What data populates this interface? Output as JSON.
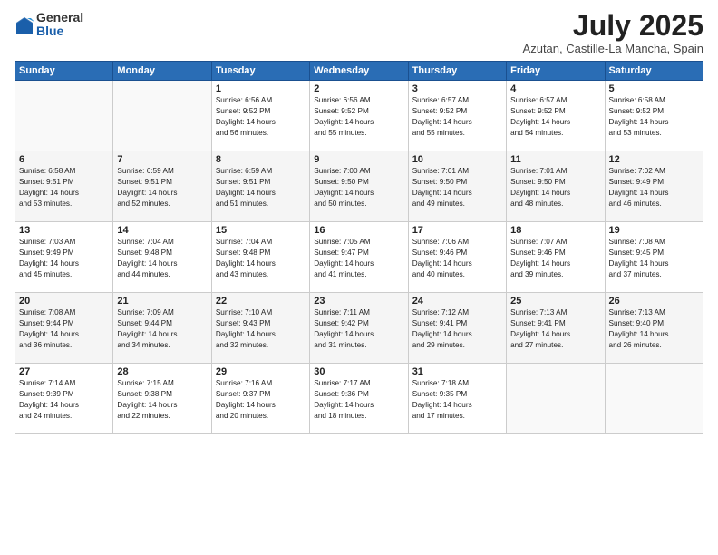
{
  "logo": {
    "general": "General",
    "blue": "Blue"
  },
  "title": "July 2025",
  "location": "Azutan, Castille-La Mancha, Spain",
  "weekdays": [
    "Sunday",
    "Monday",
    "Tuesday",
    "Wednesday",
    "Thursday",
    "Friday",
    "Saturday"
  ],
  "weeks": [
    [
      {
        "day": "",
        "info": ""
      },
      {
        "day": "",
        "info": ""
      },
      {
        "day": "1",
        "info": "Sunrise: 6:56 AM\nSunset: 9:52 PM\nDaylight: 14 hours\nand 56 minutes."
      },
      {
        "day": "2",
        "info": "Sunrise: 6:56 AM\nSunset: 9:52 PM\nDaylight: 14 hours\nand 55 minutes."
      },
      {
        "day": "3",
        "info": "Sunrise: 6:57 AM\nSunset: 9:52 PM\nDaylight: 14 hours\nand 55 minutes."
      },
      {
        "day": "4",
        "info": "Sunrise: 6:57 AM\nSunset: 9:52 PM\nDaylight: 14 hours\nand 54 minutes."
      },
      {
        "day": "5",
        "info": "Sunrise: 6:58 AM\nSunset: 9:52 PM\nDaylight: 14 hours\nand 53 minutes."
      }
    ],
    [
      {
        "day": "6",
        "info": "Sunrise: 6:58 AM\nSunset: 9:51 PM\nDaylight: 14 hours\nand 53 minutes."
      },
      {
        "day": "7",
        "info": "Sunrise: 6:59 AM\nSunset: 9:51 PM\nDaylight: 14 hours\nand 52 minutes."
      },
      {
        "day": "8",
        "info": "Sunrise: 6:59 AM\nSunset: 9:51 PM\nDaylight: 14 hours\nand 51 minutes."
      },
      {
        "day": "9",
        "info": "Sunrise: 7:00 AM\nSunset: 9:50 PM\nDaylight: 14 hours\nand 50 minutes."
      },
      {
        "day": "10",
        "info": "Sunrise: 7:01 AM\nSunset: 9:50 PM\nDaylight: 14 hours\nand 49 minutes."
      },
      {
        "day": "11",
        "info": "Sunrise: 7:01 AM\nSunset: 9:50 PM\nDaylight: 14 hours\nand 48 minutes."
      },
      {
        "day": "12",
        "info": "Sunrise: 7:02 AM\nSunset: 9:49 PM\nDaylight: 14 hours\nand 46 minutes."
      }
    ],
    [
      {
        "day": "13",
        "info": "Sunrise: 7:03 AM\nSunset: 9:49 PM\nDaylight: 14 hours\nand 45 minutes."
      },
      {
        "day": "14",
        "info": "Sunrise: 7:04 AM\nSunset: 9:48 PM\nDaylight: 14 hours\nand 44 minutes."
      },
      {
        "day": "15",
        "info": "Sunrise: 7:04 AM\nSunset: 9:48 PM\nDaylight: 14 hours\nand 43 minutes."
      },
      {
        "day": "16",
        "info": "Sunrise: 7:05 AM\nSunset: 9:47 PM\nDaylight: 14 hours\nand 41 minutes."
      },
      {
        "day": "17",
        "info": "Sunrise: 7:06 AM\nSunset: 9:46 PM\nDaylight: 14 hours\nand 40 minutes."
      },
      {
        "day": "18",
        "info": "Sunrise: 7:07 AM\nSunset: 9:46 PM\nDaylight: 14 hours\nand 39 minutes."
      },
      {
        "day": "19",
        "info": "Sunrise: 7:08 AM\nSunset: 9:45 PM\nDaylight: 14 hours\nand 37 minutes."
      }
    ],
    [
      {
        "day": "20",
        "info": "Sunrise: 7:08 AM\nSunset: 9:44 PM\nDaylight: 14 hours\nand 36 minutes."
      },
      {
        "day": "21",
        "info": "Sunrise: 7:09 AM\nSunset: 9:44 PM\nDaylight: 14 hours\nand 34 minutes."
      },
      {
        "day": "22",
        "info": "Sunrise: 7:10 AM\nSunset: 9:43 PM\nDaylight: 14 hours\nand 32 minutes."
      },
      {
        "day": "23",
        "info": "Sunrise: 7:11 AM\nSunset: 9:42 PM\nDaylight: 14 hours\nand 31 minutes."
      },
      {
        "day": "24",
        "info": "Sunrise: 7:12 AM\nSunset: 9:41 PM\nDaylight: 14 hours\nand 29 minutes."
      },
      {
        "day": "25",
        "info": "Sunrise: 7:13 AM\nSunset: 9:41 PM\nDaylight: 14 hours\nand 27 minutes."
      },
      {
        "day": "26",
        "info": "Sunrise: 7:13 AM\nSunset: 9:40 PM\nDaylight: 14 hours\nand 26 minutes."
      }
    ],
    [
      {
        "day": "27",
        "info": "Sunrise: 7:14 AM\nSunset: 9:39 PM\nDaylight: 14 hours\nand 24 minutes."
      },
      {
        "day": "28",
        "info": "Sunrise: 7:15 AM\nSunset: 9:38 PM\nDaylight: 14 hours\nand 22 minutes."
      },
      {
        "day": "29",
        "info": "Sunrise: 7:16 AM\nSunset: 9:37 PM\nDaylight: 14 hours\nand 20 minutes."
      },
      {
        "day": "30",
        "info": "Sunrise: 7:17 AM\nSunset: 9:36 PM\nDaylight: 14 hours\nand 18 minutes."
      },
      {
        "day": "31",
        "info": "Sunrise: 7:18 AM\nSunset: 9:35 PM\nDaylight: 14 hours\nand 17 minutes."
      },
      {
        "day": "",
        "info": ""
      },
      {
        "day": "",
        "info": ""
      }
    ]
  ]
}
